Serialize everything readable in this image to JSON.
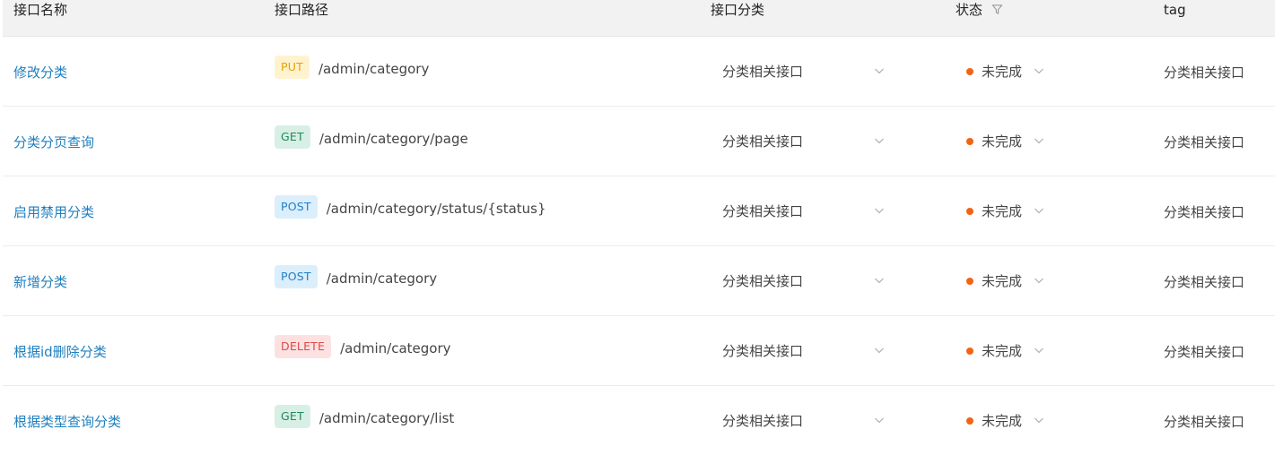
{
  "columns": {
    "name": "接口名称",
    "path": "接口路径",
    "category": "接口分类",
    "status": "状态",
    "tag": "tag"
  },
  "rows": [
    {
      "name": "修改分类",
      "method": "PUT",
      "method_class": "m-put",
      "path": "/admin/category",
      "category": "分类相关接口",
      "status": "未完成",
      "tag": "分类相关接口"
    },
    {
      "name": "分类分页查询",
      "method": "GET",
      "method_class": "m-get",
      "path": "/admin/category/page",
      "category": "分类相关接口",
      "status": "未完成",
      "tag": "分类相关接口"
    },
    {
      "name": "启用禁用分类",
      "method": "POST",
      "method_class": "m-post",
      "path": "/admin/category/status/{status}",
      "category": "分类相关接口",
      "status": "未完成",
      "tag": "分类相关接口"
    },
    {
      "name": "新增分类",
      "method": "POST",
      "method_class": "m-post",
      "path": "/admin/category",
      "category": "分类相关接口",
      "status": "未完成",
      "tag": "分类相关接口"
    },
    {
      "name": "根据id删除分类",
      "method": "DELETE",
      "method_class": "m-delete",
      "path": "/admin/category",
      "category": "分类相关接口",
      "status": "未完成",
      "tag": "分类相关接口"
    },
    {
      "name": "根据类型查询分类",
      "method": "GET",
      "method_class": "m-get",
      "path": "/admin/category/list",
      "category": "分类相关接口",
      "status": "未完成",
      "tag": "分类相关接口"
    }
  ],
  "colors": {
    "link": "#1f7fbf",
    "status_dot": "#f06414",
    "header_bg": "#f2f2f3"
  },
  "icons": {
    "status_filter": "filter-icon",
    "dropdown": "chevron-down-icon"
  }
}
